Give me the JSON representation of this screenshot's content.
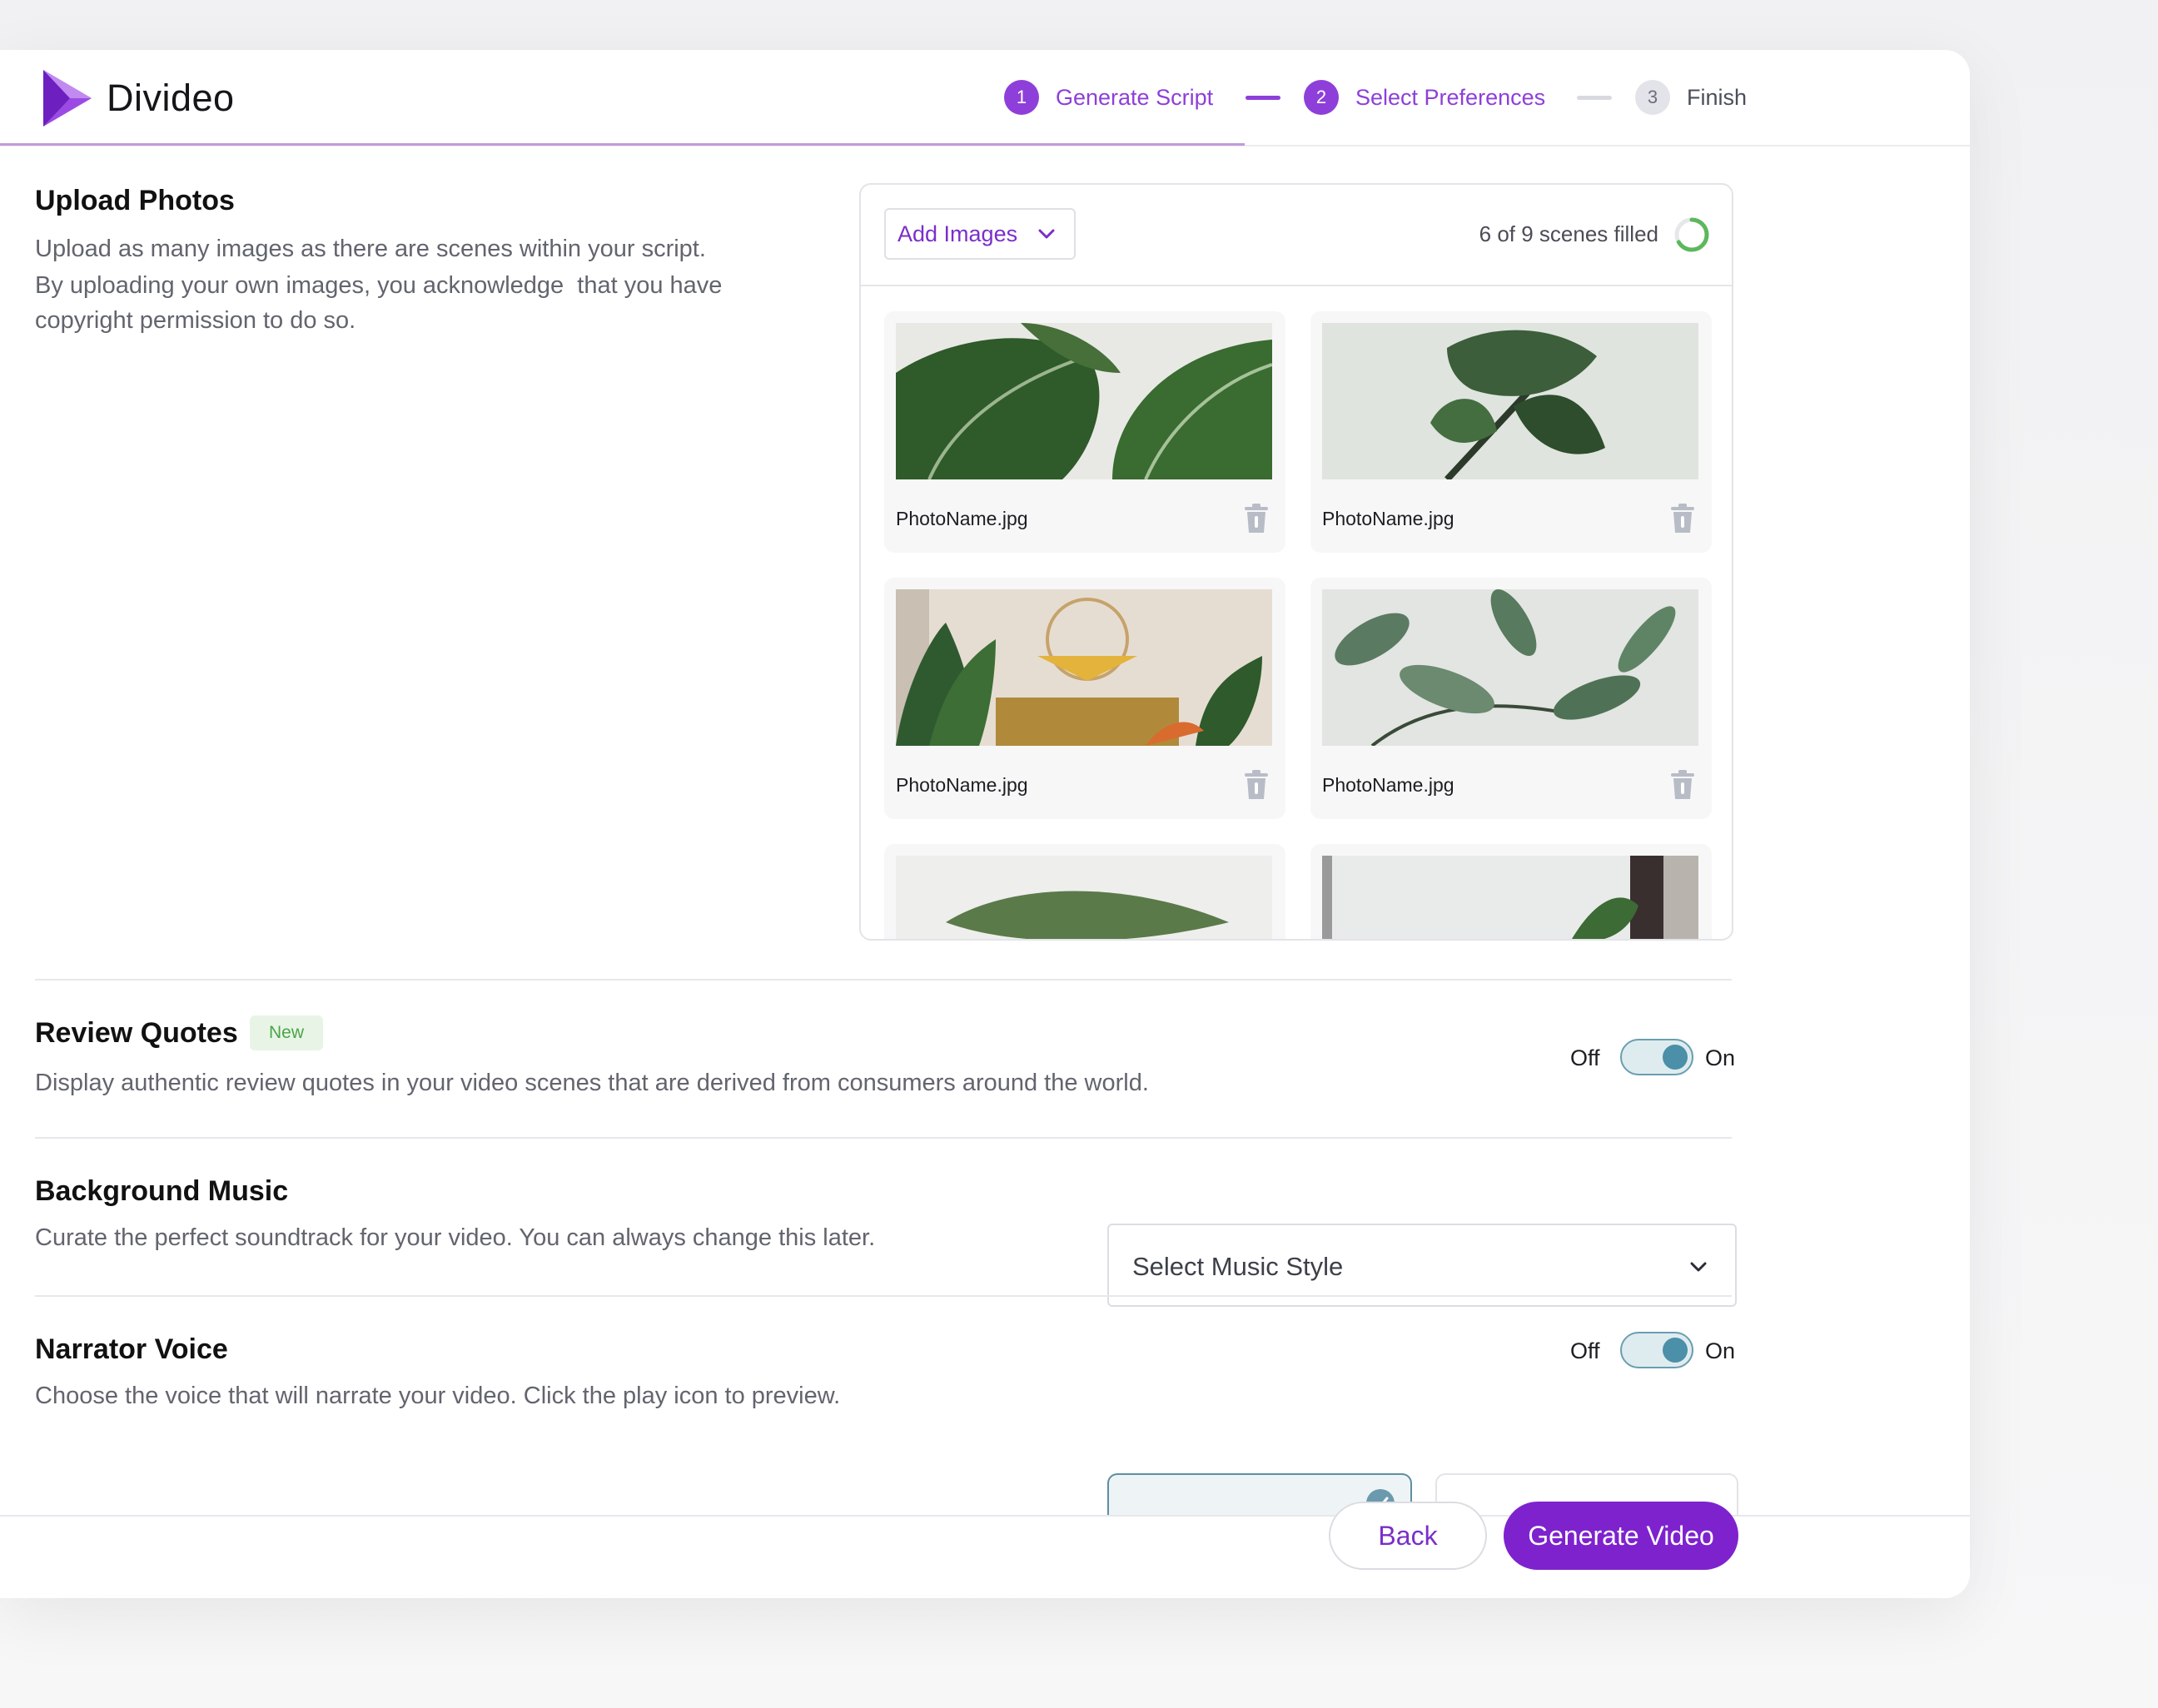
{
  "app": {
    "name": "Divideo"
  },
  "steps": [
    {
      "num": "1",
      "label": "Generate Script"
    },
    {
      "num": "2",
      "label": "Select Preferences"
    },
    {
      "num": "3",
      "label": "Finish"
    }
  ],
  "upload": {
    "title": "Upload Photos",
    "desc_line1": "Upload as many images as there are scenes within your script.",
    "desc_line2": "By uploading your own images, you acknowledge  that you have",
    "desc_line3": "copyright permission to do so.",
    "add_label": "Add Images",
    "scenes_text": "6 of 9 scenes filled",
    "scenes_filled_fraction": 0.6667,
    "photos": [
      {
        "name": "PhotoName.jpg"
      },
      {
        "name": "PhotoName.jpg"
      },
      {
        "name": "PhotoName.jpg"
      },
      {
        "name": "PhotoName.jpg"
      }
    ]
  },
  "quotes": {
    "title": "Review Quotes",
    "badge": "New",
    "desc": "Display authentic review quotes in your video scenes that are derived from consumers around the world.",
    "off": "Off",
    "on": "On"
  },
  "music": {
    "title": "Background Music",
    "desc": "Curate the perfect soundtrack for your video. You can always change this later.",
    "select_value": "Select Music Style"
  },
  "voice": {
    "title": "Narrator Voice",
    "desc": "Choose the voice that will narrate your video. Click the play icon to preview.",
    "off": "Off",
    "on": "On"
  },
  "footer": {
    "back": "Back",
    "generate": "Generate Video"
  },
  "colors": {
    "accent": "#7e22ce",
    "toggle": "#4b8fa8",
    "badge_bg": "#e8f5e6",
    "badge_text": "#4ca34a",
    "ring": "#5cb85c"
  }
}
